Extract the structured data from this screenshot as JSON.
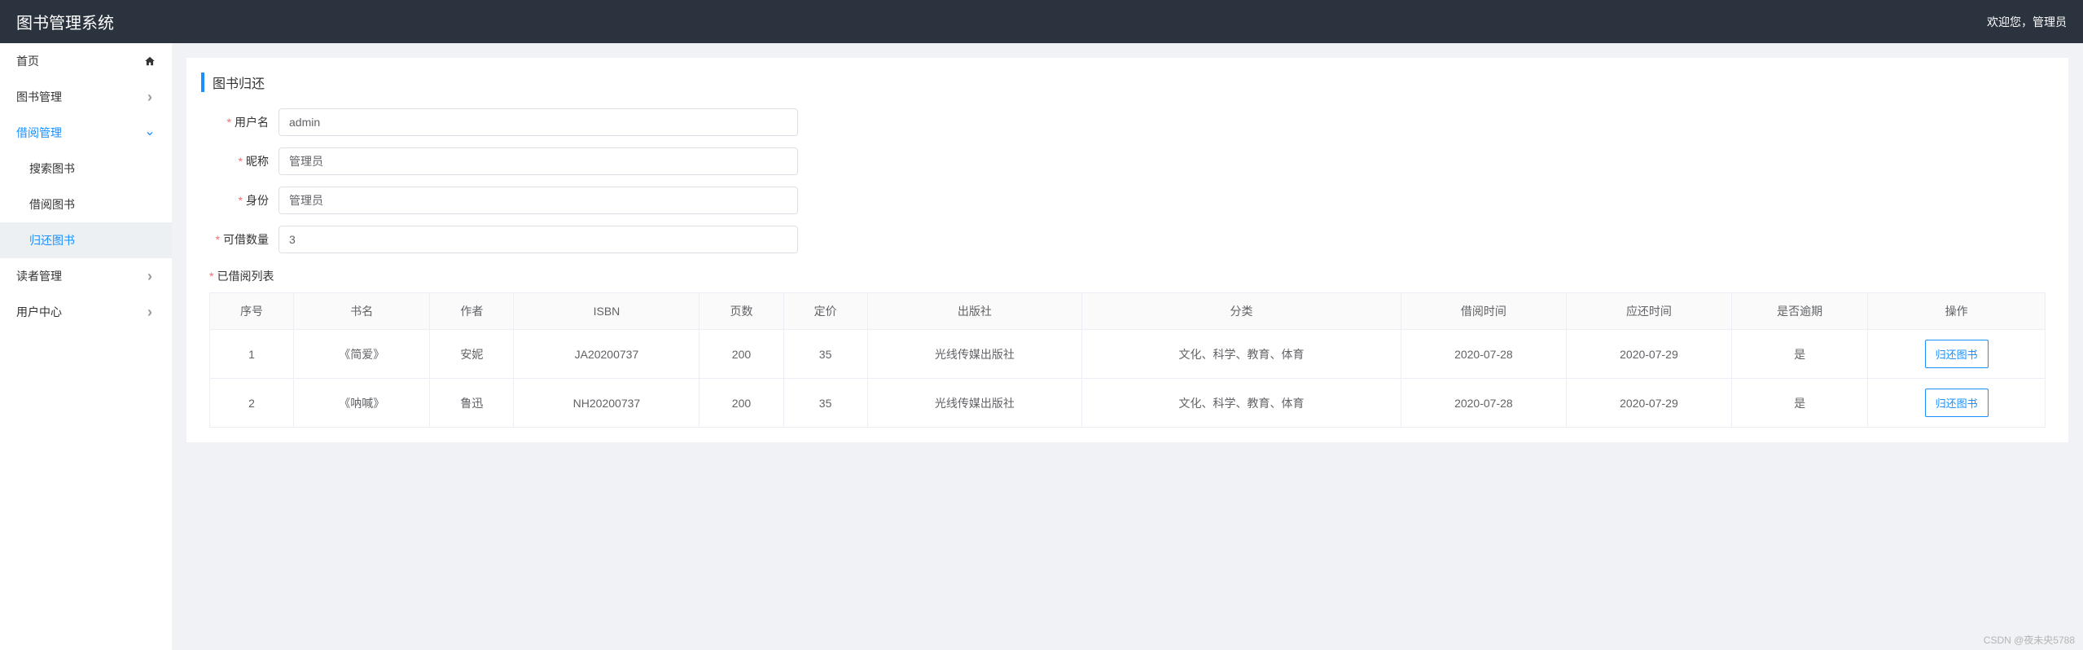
{
  "header": {
    "title": "图书管理系统",
    "welcome": "欢迎您，管理员"
  },
  "sidebar": {
    "home": "首页",
    "book_mgmt": "图书管理",
    "borrow_mgmt": "借阅管理",
    "search_book": "搜索图书",
    "borrow_book": "借阅图书",
    "return_book": "归还图书",
    "reader_mgmt": "读者管理",
    "user_center": "用户中心"
  },
  "panel": {
    "title": "图书归还"
  },
  "form": {
    "username_label": "用户名",
    "username_value": "admin",
    "nickname_label": "昵称",
    "nickname_value": "管理员",
    "role_label": "身份",
    "role_value": "管理员",
    "quota_label": "可借数量",
    "quota_value": "3",
    "list_label": "已借阅列表"
  },
  "table": {
    "headers": {
      "seq": "序号",
      "name": "书名",
      "author": "作者",
      "isbn": "ISBN",
      "pages": "页数",
      "price": "定价",
      "publisher": "出版社",
      "category": "分类",
      "borrow_time": "借阅时间",
      "due_time": "应还时间",
      "overdue": "是否逾期",
      "action": "操作"
    },
    "rows": [
      {
        "seq": "1",
        "name": "《简爱》",
        "author": "安妮",
        "isbn": "JA20200737",
        "pages": "200",
        "price": "35",
        "publisher": "光线传媒出版社",
        "category": "文化、科学、教育、体育",
        "borrow_time": "2020-07-28",
        "due_time": "2020-07-29",
        "overdue": "是",
        "action": "归还图书"
      },
      {
        "seq": "2",
        "name": "《呐喊》",
        "author": "鲁迅",
        "isbn": "NH20200737",
        "pages": "200",
        "price": "35",
        "publisher": "光线传媒出版社",
        "category": "文化、科学、教育、体育",
        "borrow_time": "2020-07-28",
        "due_time": "2020-07-29",
        "overdue": "是",
        "action": "归还图书"
      }
    ]
  },
  "watermark": "CSDN @夜未央5788"
}
